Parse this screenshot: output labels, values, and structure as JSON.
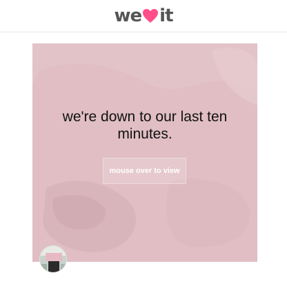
{
  "header": {
    "logo_text_left": "we",
    "logo_text_right": "it",
    "logo_heart_icon": "heart-icon",
    "brand_color": "#ff4f8b"
  },
  "post": {
    "headline": "we're down to our last ten minutes.",
    "reveal_button_label": "mouse over to view",
    "background_color": "#e2c3c8"
  }
}
